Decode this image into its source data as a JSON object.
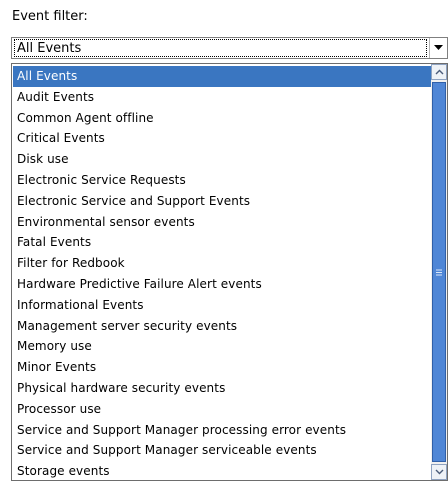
{
  "filter": {
    "label": "Event filter:",
    "selected_value": "All Events"
  },
  "list": {
    "items": [
      "All Events",
      "Audit Events",
      "Common Agent offline",
      "Critical Events",
      "Disk use",
      "Electronic Service Requests",
      "Electronic Service and Support Events",
      "Environmental sensor events",
      "Fatal Events",
      "Filter for Redbook",
      "Hardware Predictive Failure Alert events",
      "Informational Events",
      "Management server security events",
      "Memory use",
      "Minor Events",
      "Physical hardware security events",
      "Processor use",
      "Service and Support Manager processing error events",
      "Service and Support Manager serviceable events",
      "Storage events"
    ],
    "selected_index": 0
  },
  "icons": {
    "combo_arrow": "chevron-down-icon",
    "scroll_up": "chevron-up-icon",
    "scroll_down": "chevron-down-icon",
    "thumb_grip": "grip-lines-icon"
  },
  "colors": {
    "selection": "#3a76c1",
    "scroll_thumb": "#4f86d6"
  }
}
